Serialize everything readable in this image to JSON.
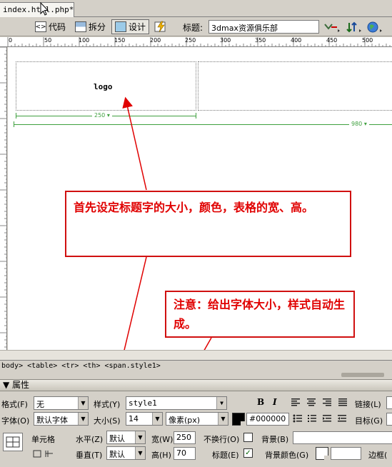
{
  "tab": {
    "filename": "index.html.php*"
  },
  "toolbar": {
    "code_label": "代码",
    "split_label": "拆分",
    "design_label": "设计",
    "title_label": "标题:",
    "title_value": "3dmax资源俱乐部"
  },
  "ruler": {
    "ticks": [
      "0",
      "50",
      "100",
      "150",
      "200",
      "250",
      "300",
      "350",
      "400",
      "450",
      "500"
    ]
  },
  "canvas": {
    "logo_text": "logo",
    "width_label_1": "250 ▾",
    "width_label_2": "980 ▾"
  },
  "callouts": {
    "first": "首先设定标题字的大小，颜色，表格的宽、高。",
    "second": "注意：给出字体大小，样式自动生成。"
  },
  "tag_selector": "body> <table> <tr> <th> <span.style1>",
  "properties": {
    "header": "▼ 属性",
    "format_label": "格式(F)",
    "format_value": "无",
    "font_label": "字体(O)",
    "font_value": "默认字体",
    "style_label": "样式(Y)",
    "style_value": "style1",
    "size_label": "大小(S)",
    "size_value": "14",
    "unit_value": "像素(px)",
    "color_value": "#000000",
    "bold": "B",
    "italic": "I",
    "link_label": "链接(L)",
    "target_label": "目标(G)",
    "cell_label": "单元格",
    "horz_label": "水平(Z)",
    "horz_value": "默认",
    "vert_label": "垂直(T)",
    "vert_value": "默认",
    "width_label": "宽(W)",
    "width_value": "250",
    "height_label": "高(H)",
    "height_value": "70",
    "nowrap_label": "不换行(O)",
    "header_label": "标题(E)",
    "bg_label": "背景(B)",
    "bgcolor_label": "背景颜色(G)",
    "border_label": "边框("
  },
  "colors": {
    "callout_red": "#e00000",
    "dim_green": "#3fa03f"
  }
}
